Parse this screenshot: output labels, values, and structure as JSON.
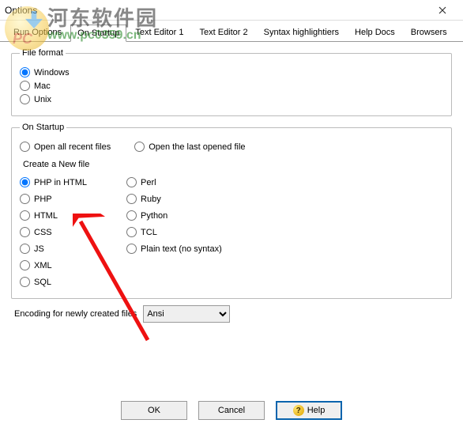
{
  "window": {
    "title": "Options"
  },
  "tabs": {
    "t0": "Run Options",
    "t1": "On Startup",
    "t2": "Text Editor 1",
    "t3": "Text Editor 2",
    "t4": "Syntax highlightiers",
    "t5": "Help Docs",
    "t6": "Browsers"
  },
  "file_format": {
    "legend": "File format",
    "windows": "Windows",
    "mac": "Mac",
    "unix": "Unix"
  },
  "startup": {
    "legend": "On Startup",
    "open_all": "Open all recent files",
    "open_last": "Open the last opened file",
    "create_label": "Create a New file",
    "php_html": "PHP in HTML",
    "php": "PHP",
    "html": "HTML",
    "css": "CSS",
    "js": "JS",
    "xml": "XML",
    "sql": "SQL",
    "perl": "Perl",
    "ruby": "Ruby",
    "python": "Python",
    "tcl": "TCL",
    "plain": "Plain text (no syntax)"
  },
  "encoding": {
    "label": "Encoding for newly created files",
    "value": "Ansi"
  },
  "buttons": {
    "ok": "OK",
    "cancel": "Cancel",
    "help": "Help"
  },
  "watermark": {
    "cn": "河东软件园",
    "url": "www.pc0359.cn",
    "pc": "PC"
  }
}
